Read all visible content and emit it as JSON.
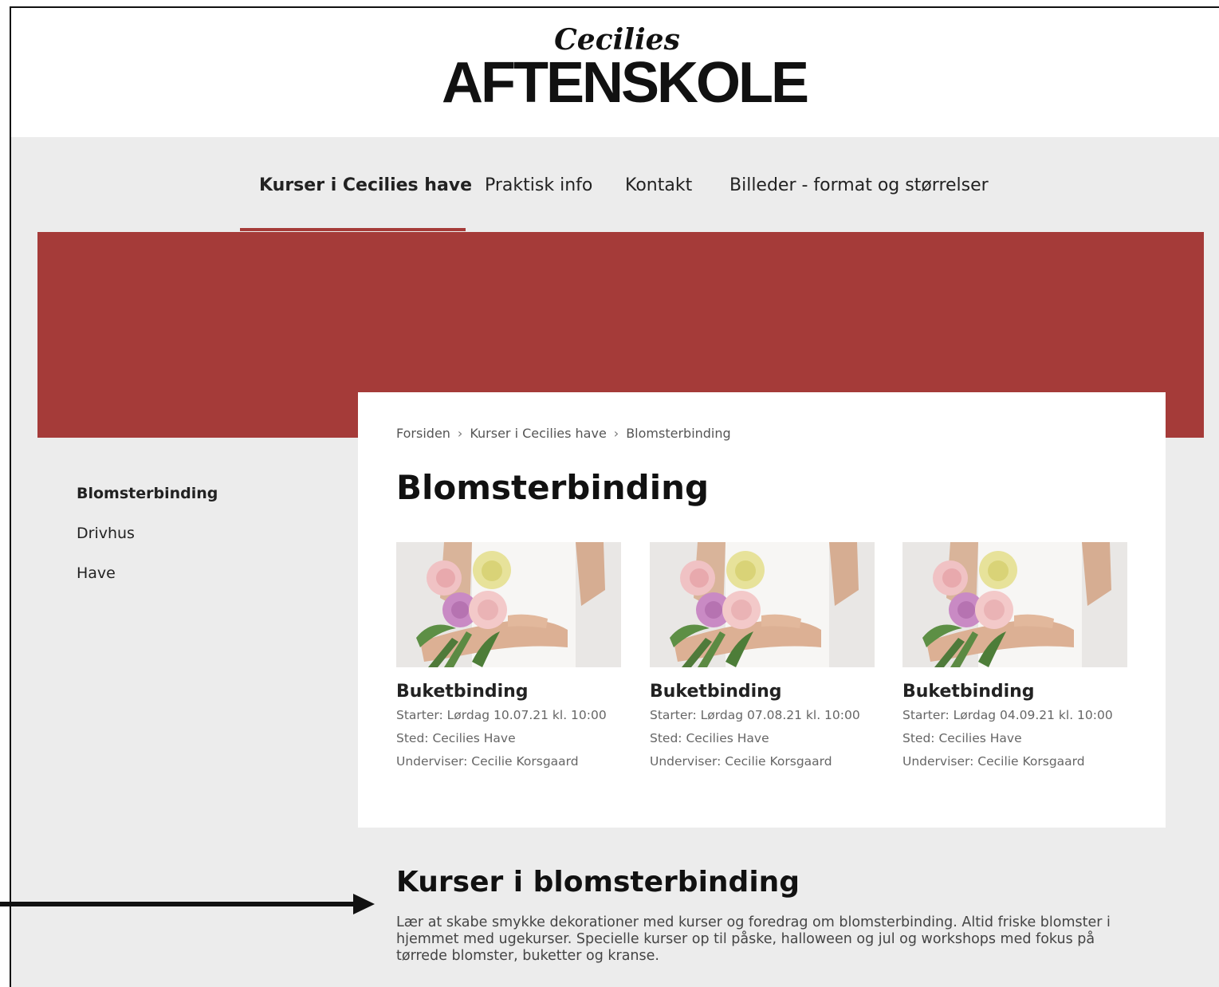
{
  "logo": {
    "script_text": "Cecilies",
    "main_text": "AFTENSKOLE"
  },
  "nav": {
    "items": [
      {
        "label": "Kurser i Cecilies have",
        "active": true
      },
      {
        "label": "Praktisk info"
      },
      {
        "label": "Kontakt"
      },
      {
        "label": "Billeder - format og størrelser"
      }
    ]
  },
  "colors": {
    "accent": "#a53b39",
    "page_bg": "#ececec",
    "card_bg": "#ffffff"
  },
  "sidebar": {
    "items": [
      {
        "label": "Blomsterbinding",
        "active": true
      },
      {
        "label": "Drivhus"
      },
      {
        "label": "Have"
      }
    ]
  },
  "breadcrumb": {
    "items": [
      "Forsiden",
      "Kurser i Cecilies have",
      "Blomsterbinding"
    ],
    "separator": "›"
  },
  "page": {
    "title": "Blomsterbinding"
  },
  "courses": [
    {
      "title": "Buketbinding",
      "start": "Starter: Lørdag 10.07.21 kl. 10:00",
      "place": "Sted: Cecilies Have",
      "teacher": "Underviser: Cecilie Korsgaard",
      "image": "bouquet-photo"
    },
    {
      "title": "Buketbinding",
      "start": "Starter: Lørdag 07.08.21 kl. 10:00",
      "place": "Sted: Cecilies Have",
      "teacher": "Underviser: Cecilie Korsgaard",
      "image": "bouquet-photo"
    },
    {
      "title": "Buketbinding",
      "start": "Starter: Lørdag 04.09.21 kl. 10:00",
      "place": "Sted: Cecilies Have",
      "teacher": "Underviser: Cecilie Korsgaard",
      "image": "bouquet-photo"
    }
  ],
  "section": {
    "title": "Kurser i blomsterbinding",
    "text": "Lær at skabe smykke dekorationer med kurser og foredrag om blomsterbinding. Altid friske blomster i hjemmet med ugekurser. Specielle kurser op til påske, halloween og jul og workshops med fokus på tørrede blomster, buketter og kranse."
  },
  "annotation": {
    "icon": "arrow-right-icon"
  }
}
